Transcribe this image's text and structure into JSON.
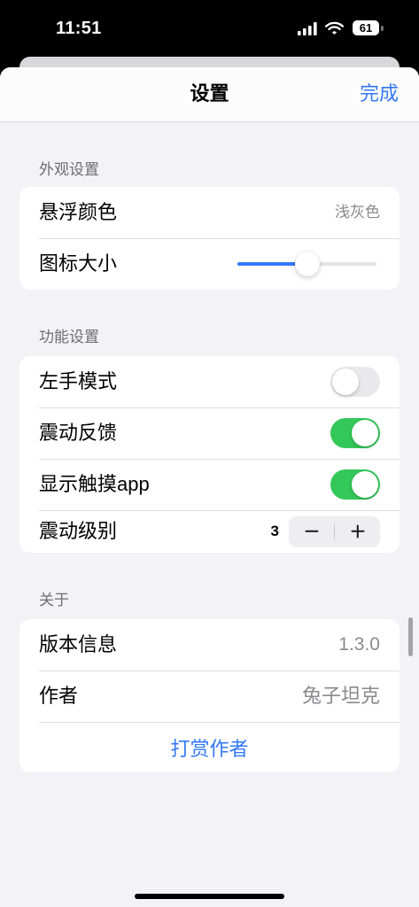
{
  "theme": {
    "accent": "#3478f6",
    "toggle_on": "#34c759",
    "toggle_off": "#e9e9eb",
    "background": "#f2f2f7",
    "secondary_text": "#8a8a8e"
  },
  "status_bar": {
    "time": "11:51",
    "battery_percent": "61",
    "icons": [
      "cellular-signal-icon",
      "wifi-icon",
      "battery-icon"
    ]
  },
  "header": {
    "title": "设置",
    "done_label": "完成"
  },
  "appearance": {
    "section_title": "外观设置",
    "float_color": {
      "label": "悬浮颜色",
      "value": "浅灰色"
    },
    "icon_size": {
      "label": "图标大小",
      "level": 0.5
    }
  },
  "features": {
    "section_title": "功能设置",
    "left_hand_mode": {
      "label": "左手模式",
      "on": false
    },
    "haptic_feedback": {
      "label": "震动反馈",
      "on": true
    },
    "show_touch_app": {
      "label": "显示触摸app",
      "on": true
    },
    "vibration_level": {
      "label": "震动级别",
      "value": "3",
      "decrement_icon": "minus-icon",
      "increment_icon": "plus-icon"
    }
  },
  "about": {
    "section_title": "关于",
    "version": {
      "label": "版本信息",
      "value": "1.3.0"
    },
    "author": {
      "label": "作者",
      "value": "兔子坦克"
    },
    "tip_label": "打赏作者"
  }
}
